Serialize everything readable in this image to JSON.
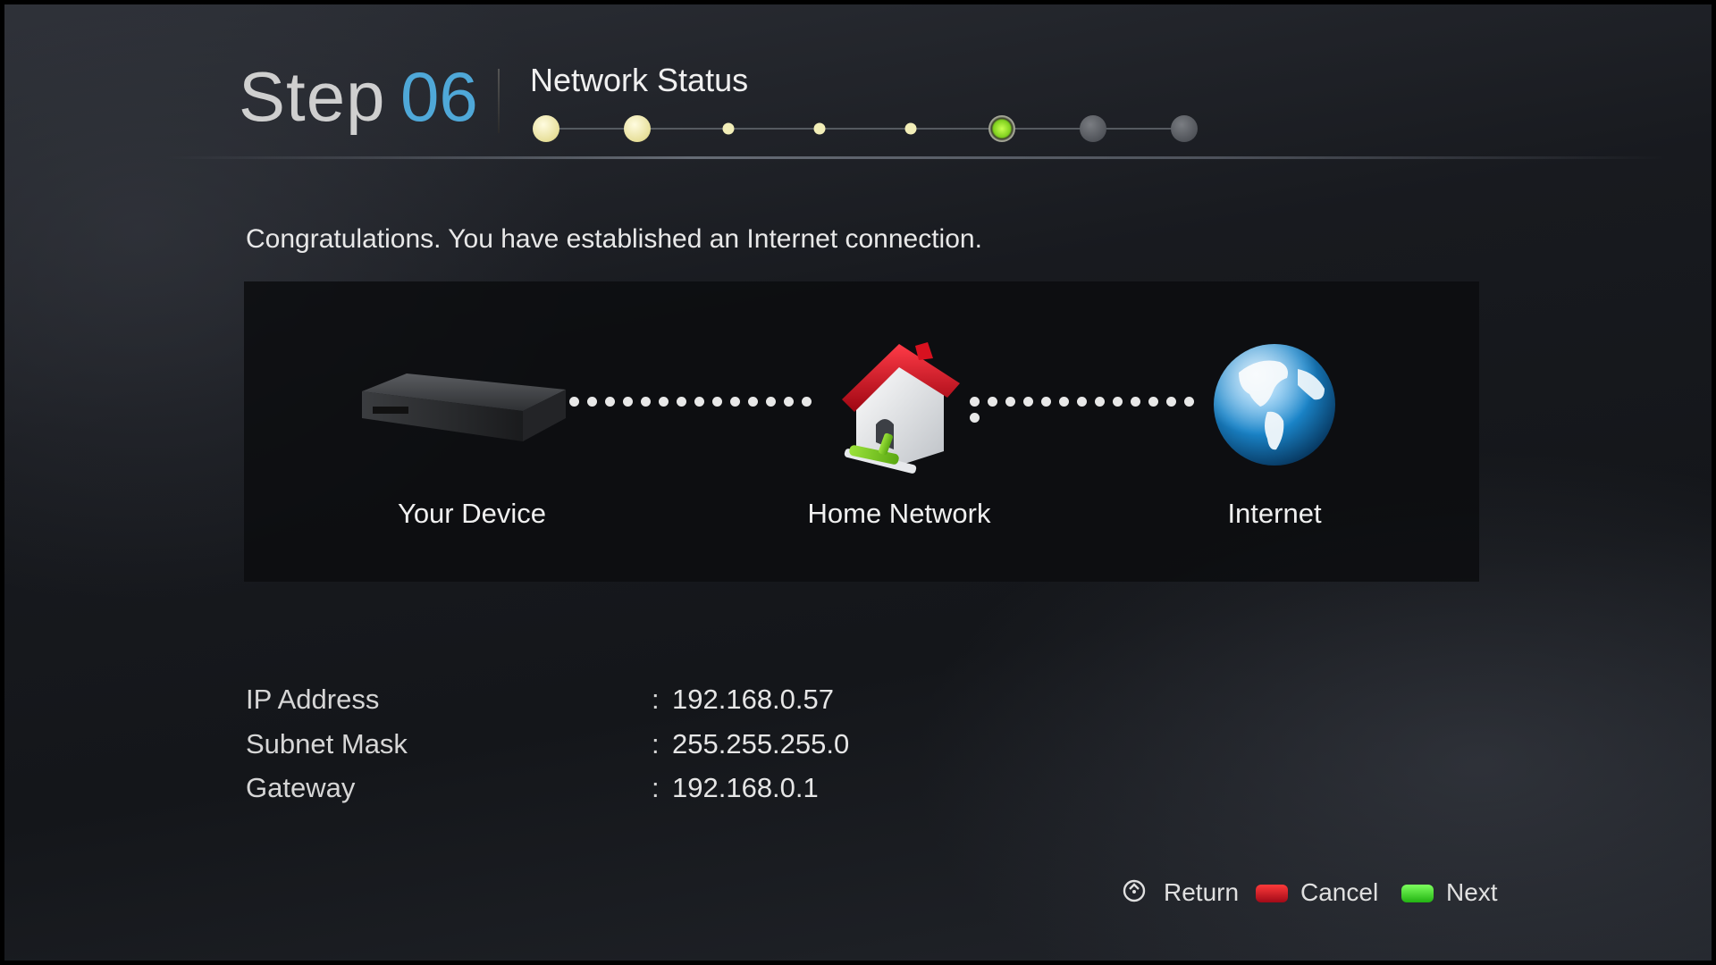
{
  "header": {
    "step_word": "Step",
    "step_number": "06",
    "title": "Network Status",
    "progress": {
      "total_steps": 8,
      "current_step": 6,
      "states": [
        "done-big",
        "done-big",
        "done-small",
        "done-small",
        "done-small",
        "current",
        "todo",
        "todo"
      ]
    }
  },
  "message": "Congratulations. You have established an Internet connection.",
  "diagram": {
    "nodes": [
      {
        "label": "Your Device",
        "icon": "set-top-box-icon"
      },
      {
        "label": "Home Network",
        "icon": "house-network-icon"
      },
      {
        "label": "Internet",
        "icon": "globe-icon"
      }
    ]
  },
  "info": {
    "ip": {
      "label": "IP Address",
      "value": "192.168.0.57"
    },
    "subnet": {
      "label": "Subnet Mask",
      "value": "255.255.255.0"
    },
    "gateway": {
      "label": "Gateway",
      "value": "192.168.0.1"
    },
    "separator": ":"
  },
  "footer": {
    "return": {
      "label": "Return",
      "icon": "return-icon"
    },
    "cancel": {
      "label": "Cancel",
      "color": "#c8102e"
    },
    "next": {
      "label": "Next",
      "color": "#2ed51a"
    }
  },
  "colors": {
    "accent": "#4fa8d8",
    "progress_done": "#f2eeb8",
    "progress_current": "#7fd01e"
  }
}
